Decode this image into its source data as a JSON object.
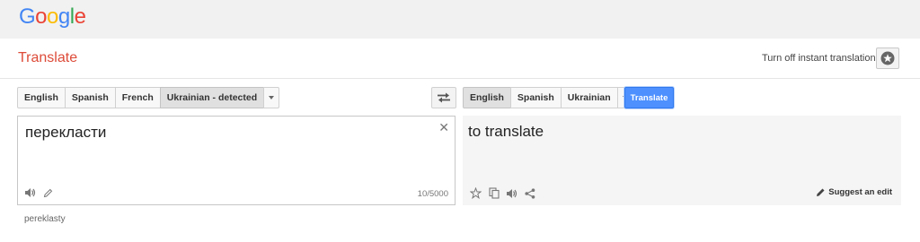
{
  "logo": [
    "G",
    "o",
    "o",
    "g",
    "l",
    "e"
  ],
  "logo_colors": [
    "#4285f4",
    "#ea4335",
    "#fbbc05",
    "#4285f4",
    "#34a853",
    "#ea4335"
  ],
  "app": {
    "title": "Translate",
    "instant_toggle": "Turn off instant translation"
  },
  "source": {
    "languages": [
      "English",
      "Spanish",
      "French",
      "Ukrainian - detected"
    ],
    "selected": "Ukrainian - detected",
    "text": "перекласти",
    "char_count": "10/5000",
    "transliteration": "pereklasty"
  },
  "target": {
    "languages": [
      "English",
      "Spanish",
      "Ukrainian"
    ],
    "selected": "English",
    "text": "to translate",
    "suggest_label": "Suggest an edit"
  },
  "translate_button": "Translate",
  "colors": {
    "accent_red": "#dd4b39",
    "button_blue": "#4d90fe"
  },
  "icons": [
    "star-icon",
    "speaker-icon",
    "pencil-icon",
    "close-icon",
    "swap-icon",
    "copy-icon",
    "share-icon",
    "edit-icon"
  ]
}
